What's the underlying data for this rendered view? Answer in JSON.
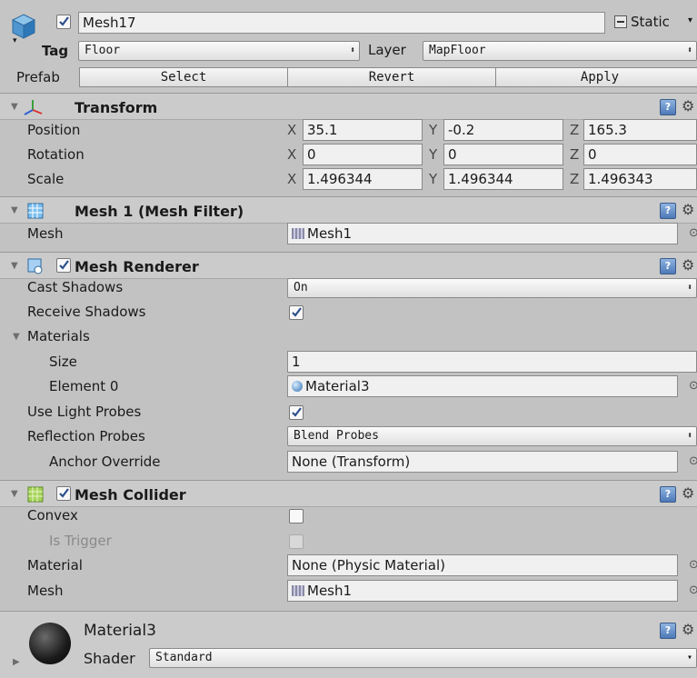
{
  "object": {
    "name": "Mesh17",
    "static_label": "Static",
    "tag_label": "Tag",
    "tag_value": "Floor",
    "layer_label": "Layer",
    "layer_value": "MapFloor",
    "prefab_label": "Prefab",
    "prefab_select": "Select",
    "prefab_revert": "Revert",
    "prefab_apply": "Apply"
  },
  "transform": {
    "title": "Transform",
    "position_label": "Position",
    "rotation_label": "Rotation",
    "scale_label": "Scale",
    "x": "X",
    "y": "Y",
    "z": "Z",
    "position": {
      "x": "35.1",
      "y": "-0.2",
      "z": "165.3"
    },
    "rotation": {
      "x": "0",
      "y": "0",
      "z": "0"
    },
    "scale": {
      "x": "1.496344",
      "y": "1.496344",
      "z": "1.496343"
    }
  },
  "mesh_filter": {
    "title": "Mesh 1 (Mesh Filter)",
    "mesh_label": "Mesh",
    "mesh_value": "Mesh1"
  },
  "mesh_renderer": {
    "title": "Mesh Renderer",
    "cast_shadows_label": "Cast Shadows",
    "cast_shadows_value": "On",
    "receive_shadows_label": "Receive Shadows",
    "materials_label": "Materials",
    "size_label": "Size",
    "size_value": "1",
    "element0_label": "Element 0",
    "element0_value": "Material3",
    "use_light_probes_label": "Use Light Probes",
    "reflection_probes_label": "Reflection Probes",
    "reflection_probes_value": "Blend Probes",
    "anchor_override_label": "Anchor Override",
    "anchor_override_value": "None (Transform)"
  },
  "mesh_collider": {
    "title": "Mesh Collider",
    "convex_label": "Convex",
    "is_trigger_label": "Is Trigger",
    "material_label": "Material",
    "material_value": "None (Physic Material)",
    "mesh_label": "Mesh",
    "mesh_value": "Mesh1"
  },
  "material": {
    "name": "Material3",
    "shader_label": "Shader",
    "shader_value": "Standard"
  },
  "glyphs": {
    "help": "?",
    "gear": "⚙",
    "dot": "⊙",
    "fold": "▼",
    "expand": "▶",
    "dropdown_arrow": "⬍",
    "dropdown_arrow_small": "▾"
  }
}
